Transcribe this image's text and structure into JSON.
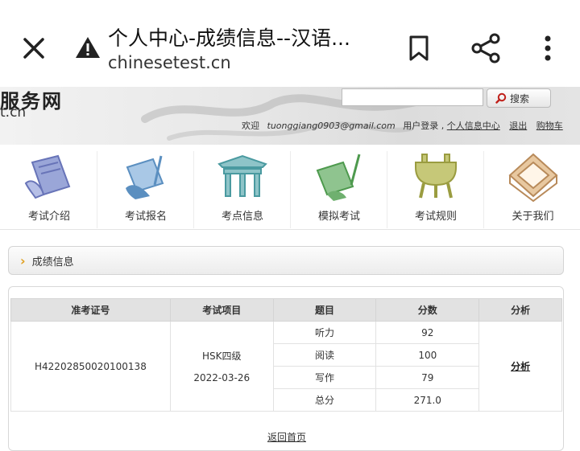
{
  "browser": {
    "title": "个人中心-成绩信息--汉语...",
    "url": "chinesetest.cn",
    "icons": [
      "close-icon",
      "warning-icon",
      "bookmark-icon",
      "share-icon",
      "more-vert-icon"
    ]
  },
  "header": {
    "logo_text": "服务网",
    "logo_sub": "t.cn",
    "search_value": "",
    "search_button": "搜索",
    "welcome": "欢迎",
    "email": "tuonggiang0903@gmail.com",
    "login_type": "用户登录 ,",
    "links": [
      "个人信息中心",
      "退出",
      "购物车"
    ]
  },
  "nav": {
    "items": [
      {
        "label": "考试介绍",
        "icon": "scroll-icon"
      },
      {
        "label": "考试报名",
        "icon": "scroll-quill-icon"
      },
      {
        "label": "考点信息",
        "icon": "pavilion-icon"
      },
      {
        "label": "模拟考试",
        "icon": "brush-scroll-icon"
      },
      {
        "label": "考试规则",
        "icon": "ding-cauldron-icon"
      },
      {
        "label": "关于我们",
        "icon": "square-frame-icon"
      }
    ]
  },
  "section": {
    "title": "成绩信息"
  },
  "table": {
    "headers": [
      "准考证号",
      "考试项目",
      "题目",
      "分数",
      "分析"
    ],
    "candidate_id": "H42202850020100138",
    "exam": "HSK四级",
    "date": "2022-03-26",
    "rows": [
      {
        "item": "听力",
        "score": "92"
      },
      {
        "item": "阅读",
        "score": "100"
      },
      {
        "item": "写作",
        "score": "79"
      },
      {
        "item": "总分",
        "score": "271.0"
      }
    ],
    "analysis_link": "分析",
    "home_link": "返回首页"
  },
  "colors": {
    "accent_chevron": "#e0a020",
    "header_gray": "#e2e2e2"
  }
}
